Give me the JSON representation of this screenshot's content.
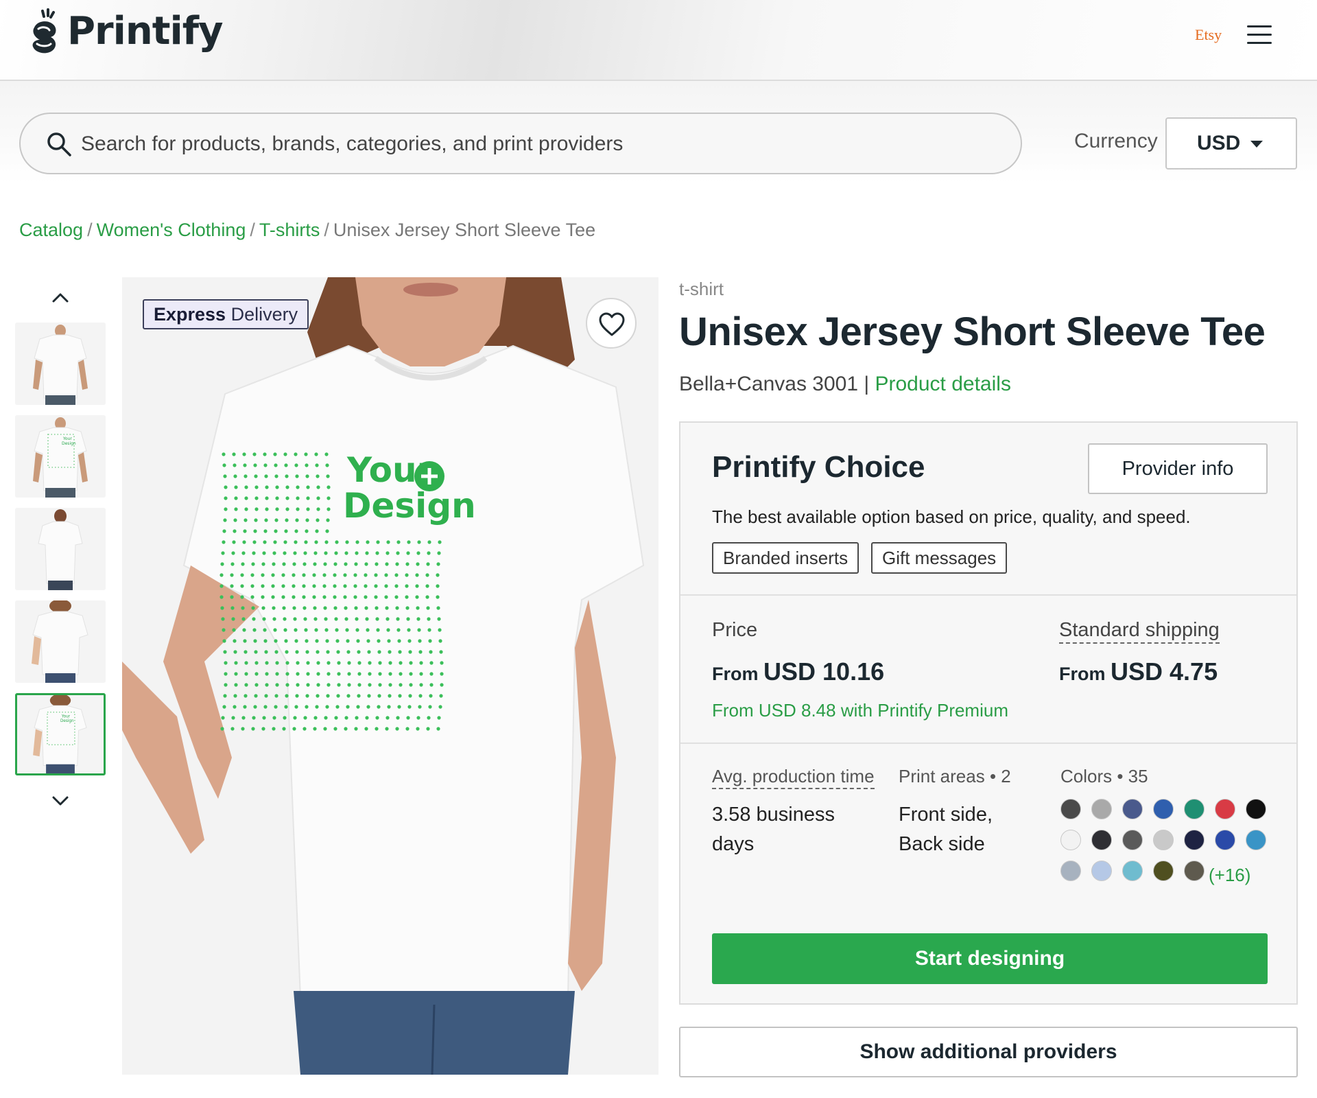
{
  "header": {
    "logo_text": "Printify",
    "etsy_label": "Etsy"
  },
  "search": {
    "placeholder": "Search for products, brands, categories, and print providers"
  },
  "currency": {
    "label": "Currency",
    "value": "USD"
  },
  "breadcrumb": {
    "items": [
      "Catalog",
      "Women's Clothing",
      "T-shirts"
    ],
    "current": "Unisex Jersey Short Sleeve Tee",
    "separator": "/"
  },
  "gallery": {
    "express_bold": "Express",
    "express_rest": " Delivery",
    "design_text_1": "Your",
    "design_text_2": "Design"
  },
  "product": {
    "type": "t-shirt",
    "title": "Unisex Jersey Short Sleeve Tee",
    "model": "Bella+Canvas 3001 |",
    "details_link": "Product details"
  },
  "provider": {
    "title": "Printify Choice",
    "info_button": "Provider info",
    "description": "The best available option based on price, quality, and speed.",
    "tags": [
      "Branded inserts",
      "Gift messages"
    ],
    "price_label": "Price",
    "price_from": "From",
    "price_value": "USD 10.16",
    "premium_text": "From USD 8.48 with Printify Premium",
    "shipping_label": "Standard shipping",
    "shipping_from": "From",
    "shipping_value": "USD 4.75",
    "production_label": "Avg. production time",
    "production_value": "3.58 business days",
    "print_areas_label": "Print areas • 2",
    "print_areas_value": "Front side, Back side",
    "colors_label": "Colors • 35",
    "colors_more": "(+16)",
    "swatches": [
      "#4a4a4a",
      "#a9a9a9",
      "#4a5a8c",
      "#2f5fae",
      "#1f8f72",
      "#d83b45",
      "#111111",
      "#f2f2f2",
      "#2e2e33",
      "#5a5a5a",
      "#c9c9c9",
      "#1e2342",
      "#2a4aa8",
      "#3a94c6",
      "#a7b2bf",
      "#b5c8e6",
      "#6fbccf",
      "#4f4f20",
      "#5e5a4e"
    ],
    "cta": "Start designing"
  },
  "additional_providers": "Show additional providers",
  "colors": {
    "accent_green": "#2aa84e",
    "link_green": "#2a9d46",
    "text_dark": "#1c2830"
  }
}
